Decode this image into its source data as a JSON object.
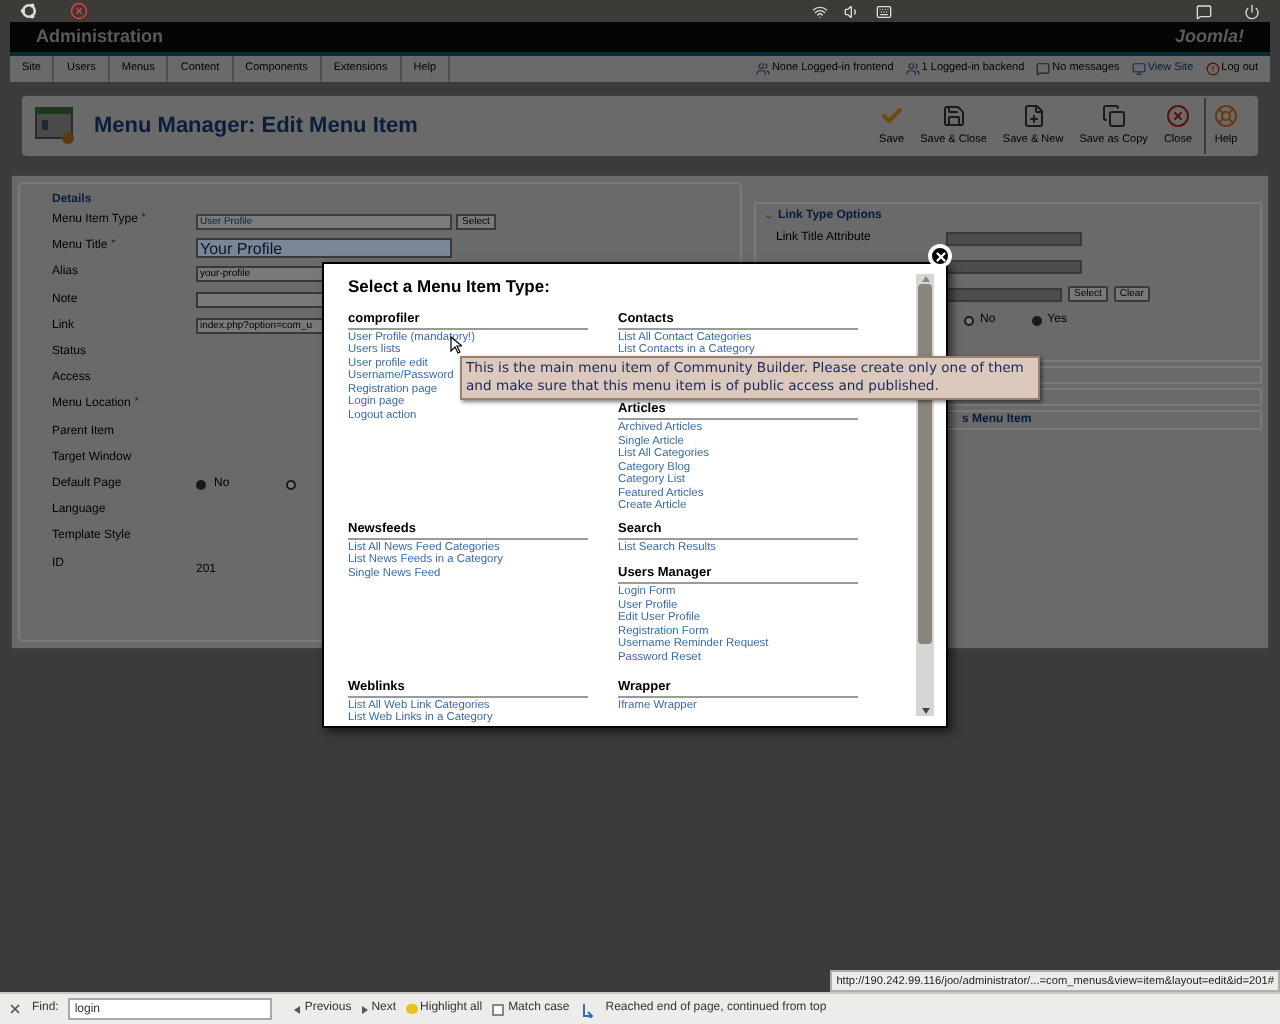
{
  "header": {
    "title": "Administration",
    "logo": "Joomla!"
  },
  "menu": [
    "Site",
    "Users",
    "Menus",
    "Content",
    "Components",
    "Extensions",
    "Help"
  ],
  "status_links": [
    {
      "label": "None Logged-in frontend",
      "kind": "users"
    },
    {
      "label": "1 Logged-in backend",
      "kind": "users"
    },
    {
      "label": "No messages",
      "kind": "messages"
    },
    {
      "label": "View Site",
      "kind": "site"
    },
    {
      "label": "Log out",
      "kind": "logout"
    }
  ],
  "page_title": "Menu Manager: Edit Menu Item",
  "toolbar": [
    {
      "label": "Save",
      "kind": "save"
    },
    {
      "label": "Save & Close",
      "kind": "disk"
    },
    {
      "label": "Save & New",
      "kind": "disk-new"
    },
    {
      "label": "Save as Copy",
      "kind": "copy"
    },
    {
      "label": "Close",
      "kind": "close"
    },
    {
      "label": "Help",
      "kind": "help"
    }
  ],
  "details": {
    "legend": "Details",
    "rows": [
      {
        "label": "Menu Item Type",
        "required_mark": "*",
        "kind": "select",
        "value": "User Profile",
        "button": "Select"
      },
      {
        "label": "Menu Title",
        "required_mark": "*",
        "kind": "title",
        "value": "Your Profile"
      },
      {
        "label": "Alias",
        "kind": "text",
        "value": "your-profile"
      },
      {
        "label": "Note",
        "kind": "text"
      },
      {
        "label": "Link",
        "kind": "text",
        "value": "index.php?option=com_u"
      },
      {
        "label": "Status",
        "kind": "none"
      },
      {
        "label": "Access",
        "kind": "none"
      },
      {
        "label": "Menu Location",
        "required_mark": "*",
        "kind": "none"
      },
      {
        "label": "Parent Item",
        "kind": "none"
      },
      {
        "label": "Target Window",
        "kind": "none"
      },
      {
        "label": "Default Page",
        "kind": "radio",
        "options": [
          {
            "label": "No",
            "selected": true
          },
          {
            "selected": false
          }
        ]
      },
      {
        "label": "Language",
        "kind": "none"
      },
      {
        "label": "Template Style",
        "kind": "none"
      },
      {
        "label": "ID",
        "kind": "static",
        "value": "201"
      }
    ]
  },
  "link_options": {
    "title": "Link Type Options",
    "field_label": "Link Title Attribute",
    "buttons": [
      "Select",
      "Clear"
    ],
    "radios": [
      {
        "label": "No",
        "selected": false
      },
      {
        "label": "Yes",
        "selected": true
      }
    ],
    "panel_title": "s Menu Item"
  },
  "modal": {
    "title": "Select a Menu Item Type:",
    "rows": [
      {
        "left": [
          {
            "title": "comprofiler",
            "items": [
              "User Profile (mandatory!)",
              "Users lists",
              "User profile edit",
              "Username/Password",
              "Registration page",
              "Login page",
              "Logout action"
            ]
          }
        ],
        "right": [
          {
            "title": "Contacts",
            "items": [
              "List All Contact Categories",
              "List Contacts in a Category"
            ]
          },
          {
            "title": "Articles",
            "items": [
              "Archived Articles",
              "Single Article",
              "List All Categories",
              "Category Blog",
              "Category List",
              "Featured Articles",
              "Create Article"
            ]
          }
        ]
      },
      {
        "left": [
          {
            "title": "Newsfeeds",
            "items": [
              "List All News Feed Categories",
              "List News Feeds in a Category",
              "Single News Feed"
            ]
          }
        ],
        "right": [
          {
            "title": "Search",
            "items": [
              "List Search Results"
            ]
          },
          {
            "title": "Users Manager",
            "items": [
              "Login Form",
              "User Profile",
              "Edit User Profile",
              "Registration Form",
              "Username Reminder Request",
              "Password Reset"
            ]
          }
        ]
      },
      {
        "left": [
          {
            "title": "Weblinks",
            "items": [
              "List All Web Link Categories",
              "List Web Links in a Category"
            ]
          }
        ],
        "right": [
          {
            "title": "Wrapper",
            "items": [
              "Iframe Wrapper"
            ]
          }
        ]
      }
    ]
  },
  "tooltip": "This is the main menu item of Community Builder. Please create only one of them and make sure that this menu item is of public access and published.",
  "status_url": "http://190.242.99.116/joo/administrator/...=com_menus&view=item&layout=edit&id=201#",
  "find_bar": {
    "label": "Find:",
    "value": "login",
    "previous": "Previous",
    "next": "Next",
    "highlight": "Highlight all",
    "match_case": {
      "label": "Match case",
      "checked": false
    },
    "message": "Reached end of page, continued from top"
  }
}
